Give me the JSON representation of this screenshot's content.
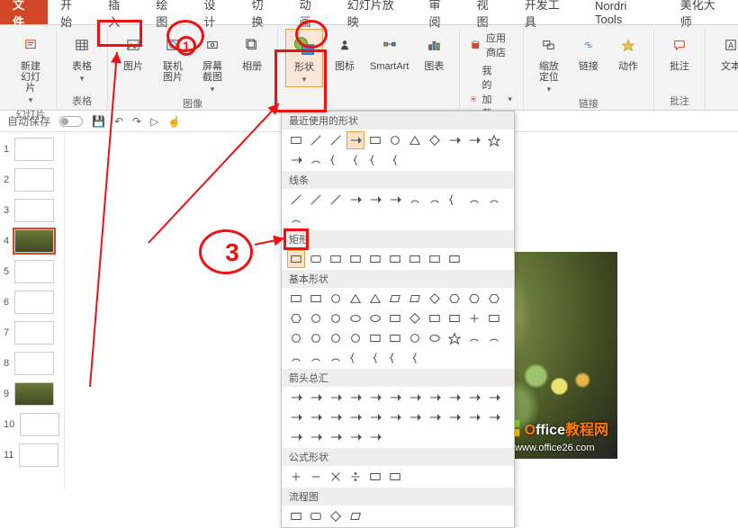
{
  "tabs": {
    "file": "文件",
    "home": "开始",
    "insert": "插入",
    "draw": "绘图",
    "design": "设计",
    "transition": "切换",
    "animation": "动画",
    "slideshow": "幻灯片放映",
    "review": "审阅",
    "view": "视图",
    "developer": "开发工具",
    "nordri": "Nordri Tools",
    "beautify": "美化大师"
  },
  "ribbon": {
    "new_slide": "新建\n幻灯片",
    "table": "表格",
    "pictures": "图片",
    "online_pics": "联机图片",
    "screenshot": "屏幕截图",
    "album": "相册",
    "shapes": "形状",
    "icons": "图标",
    "smartart": "SmartArt",
    "chart": "图表",
    "store": "应用商店",
    "addins": "我的加载项",
    "zoom": "缩放定位",
    "link": "链接",
    "action": "动作",
    "comment": "批注",
    "text": "文本",
    "group_slides": "幻灯片",
    "group_tables": "表格",
    "group_images": "图像",
    "group_addins": "",
    "group_links": "链接",
    "group_comments": "批注"
  },
  "quickbar": {
    "autosave": "自动保存"
  },
  "shapes_menu": {
    "recent": "最近使用的形状",
    "lines": "线条",
    "rectangles": "矩形",
    "basic": "基本形状",
    "arrows": "箭头总汇",
    "equation": "公式形状",
    "flowchart": "流程图"
  },
  "slides": [
    {
      "num": "1"
    },
    {
      "num": "2"
    },
    {
      "num": "3"
    },
    {
      "num": "4"
    },
    {
      "num": "5"
    },
    {
      "num": "6"
    },
    {
      "num": "7"
    },
    {
      "num": "8"
    },
    {
      "num": "9"
    },
    {
      "num": "10"
    },
    {
      "num": "11"
    }
  ],
  "watermark": {
    "brand_o": "O",
    "brand1": "ffice",
    "brand2": "教程网",
    "url": "www.office26.com"
  },
  "colors": {
    "accent": "#d24726",
    "annot": "#e11"
  }
}
